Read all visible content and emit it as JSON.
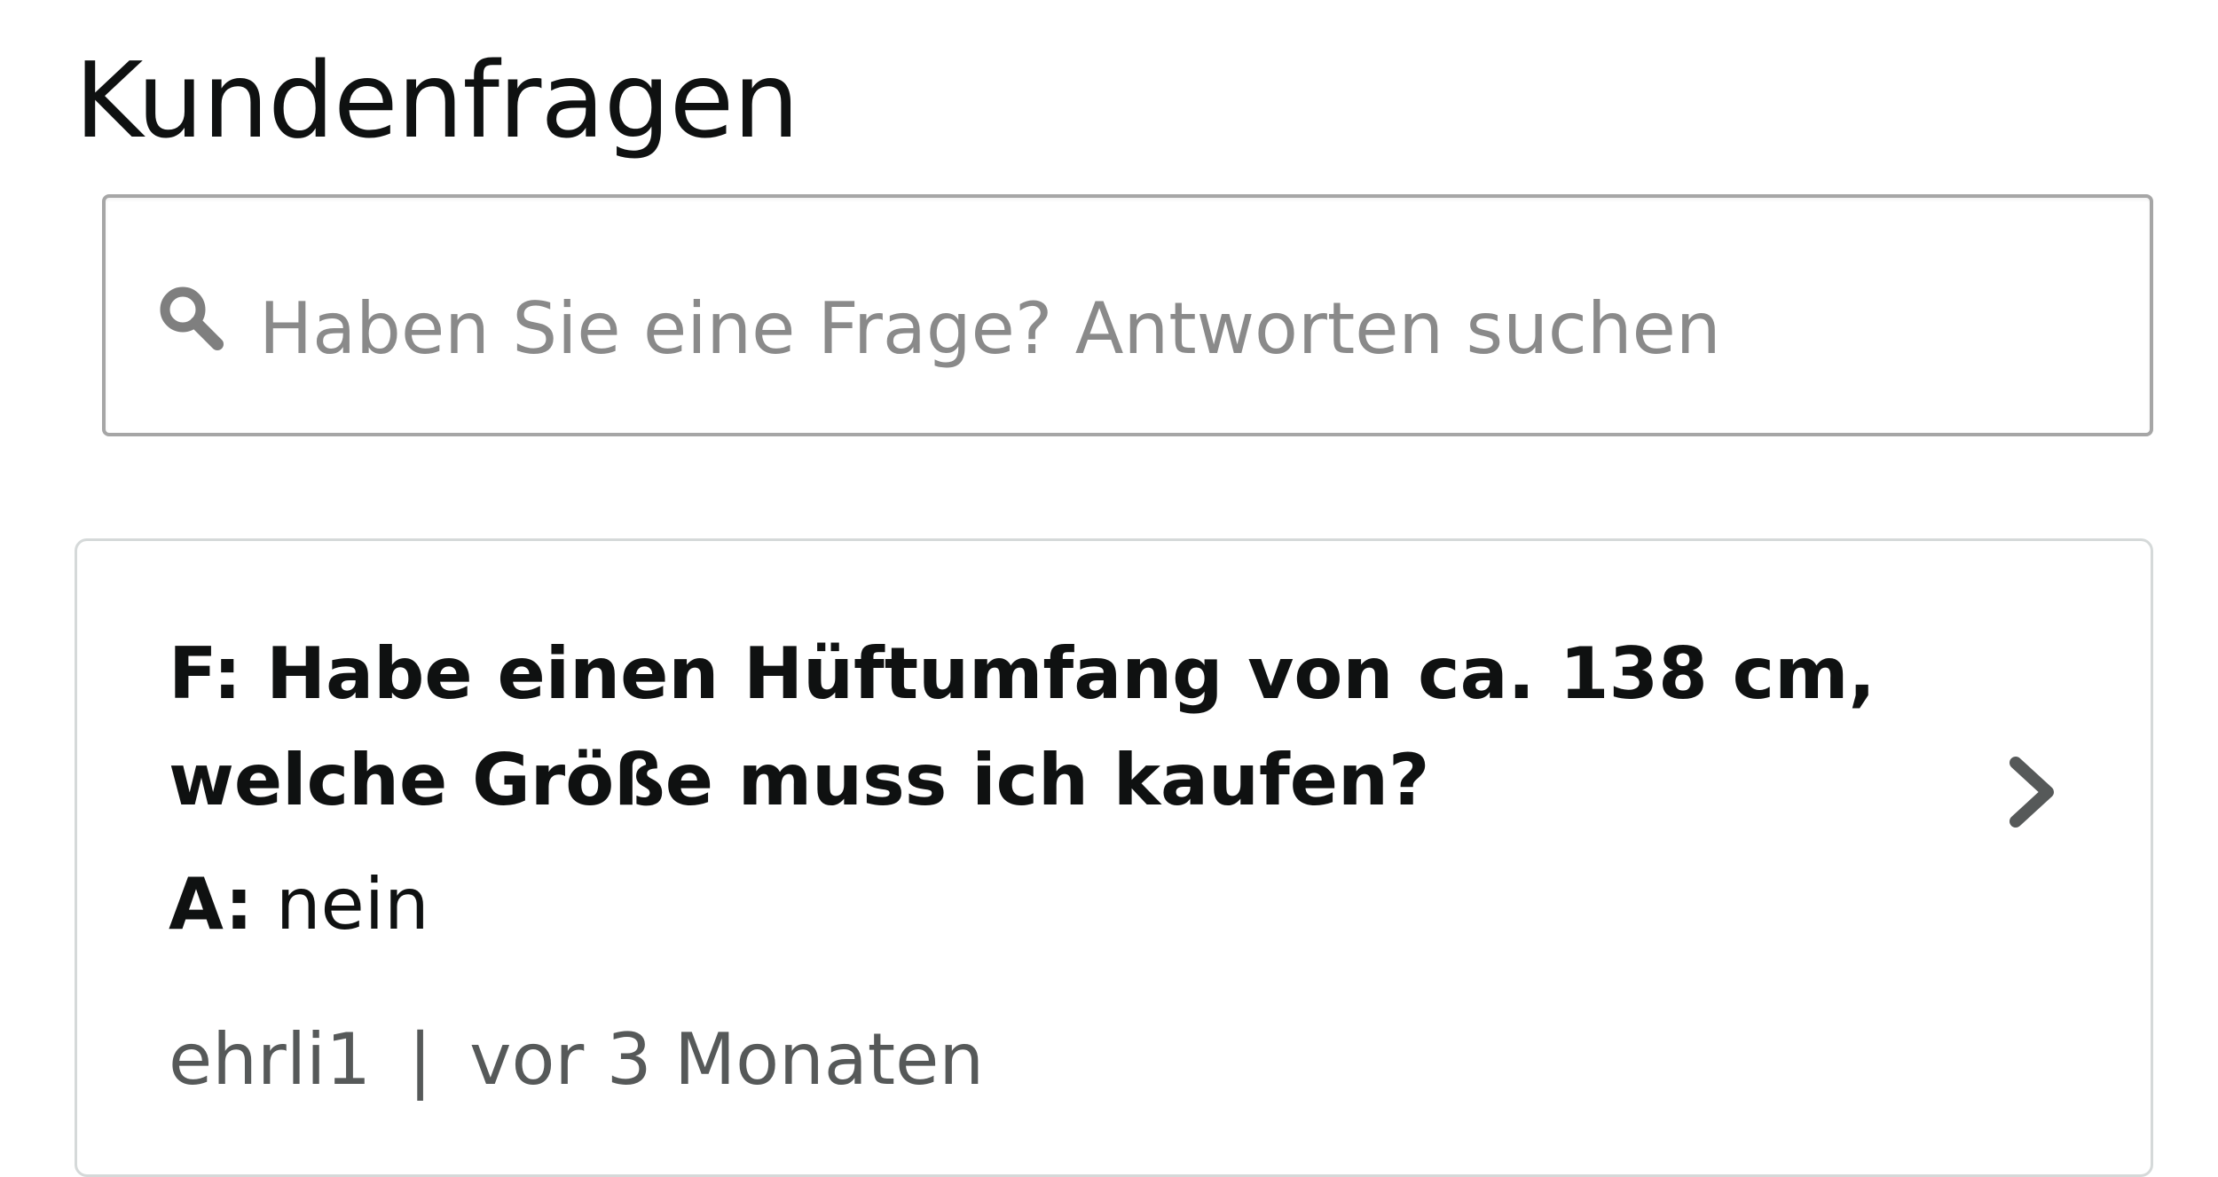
{
  "header": {
    "title": "Kundenfragen"
  },
  "search": {
    "icon": "search-icon",
    "placeholder": "Haben Sie eine Frage? Antworten suchen",
    "value": ""
  },
  "qa_card": {
    "question_prefix": "F:",
    "question_text": "Habe einen Hüftumfang von ca. 138 cm, welche Größe muss ich kaufen?",
    "answer_prefix": "A:",
    "answer_text": "nein",
    "author": "ehrli1",
    "separator": "|",
    "time_ago": "vor 3 Monaten",
    "chevron_icon": "chevron-right-icon"
  },
  "colors": {
    "text_primary": "#0f1111",
    "text_secondary": "#565959",
    "placeholder": "#8a8a8a",
    "input_border": "#a6a6a6",
    "card_border": "#d5d9d9",
    "icon_gray": "#7f7f7f"
  }
}
